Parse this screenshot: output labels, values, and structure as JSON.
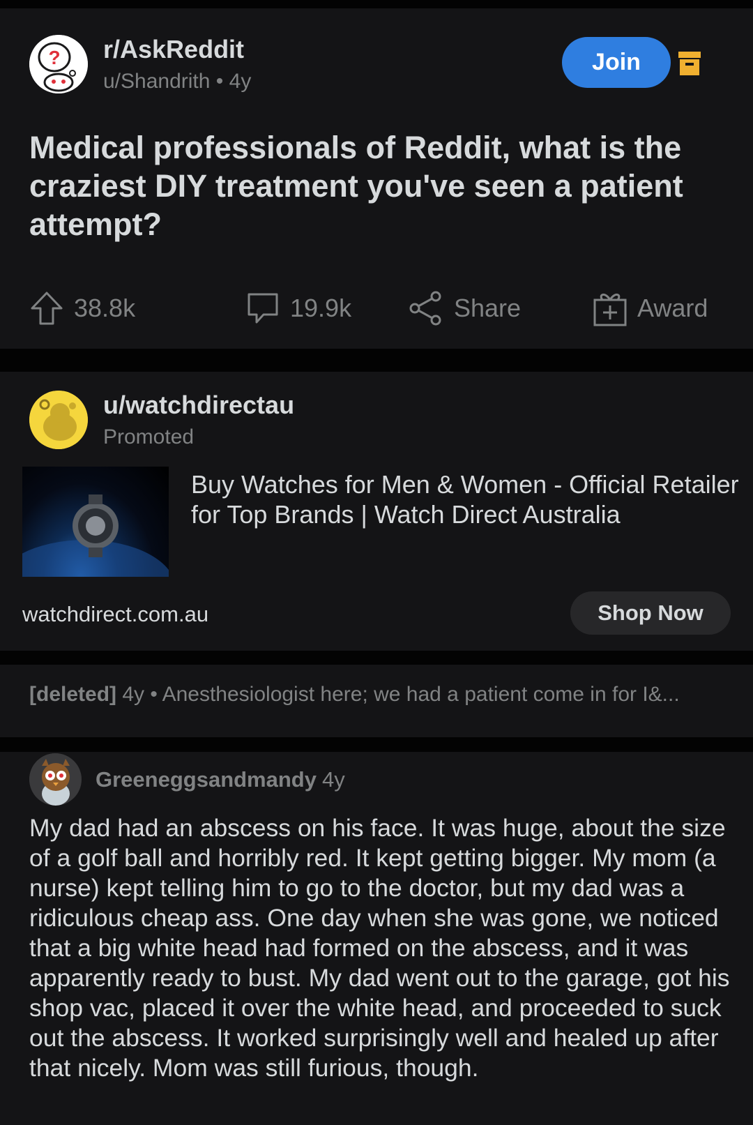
{
  "post": {
    "subreddit": "r/AskReddit",
    "author": "u/Shandrith",
    "separator": "•",
    "age": "4y",
    "join_label": "Join",
    "title": "Medical professionals of Reddit, what is the craziest DIY treatment you've seen a patient attempt?",
    "actions": {
      "upvotes": "38.8k",
      "comments": "19.9k",
      "share": "Share",
      "award": "Award"
    }
  },
  "ad": {
    "user": "u/watchdirectau",
    "label": "Promoted",
    "headline": "Buy Watches for Men & Women - Official Retailer for Top Brands | Watch Direct Australia",
    "domain": "watchdirect.com.au",
    "cta": "Shop Now"
  },
  "collapsed_comment": {
    "author": "[deleted]",
    "age": "4y",
    "separator": "•",
    "preview": "Anesthesiologist here; we had a patient come in for I&..."
  },
  "comment": {
    "author": "Greeneggsandmandy",
    "age": "4y",
    "body": "My dad had an abscess on his face.  It was huge, about the size of a golf ball and horribly red.  It kept getting bigger.  My mom (a nurse) kept telling him to go to the doctor, but my dad was a ridiculous cheap ass.  One day when she was gone, we noticed that a big white head had formed on the abscess, and it was apparently ready to bust.  My dad went out to the garage, got his shop vac, placed it over the white head, and proceeded to suck out the abscess.  It worked surprisingly well and healed up after that nicely.  Mom was still furious, though."
  },
  "colors": {
    "background": "#030303",
    "card": "#141416",
    "join": "#2f7ee0",
    "archive": "#f0b030",
    "muted": "#818384",
    "text": "#d7dadc"
  },
  "icons": [
    "subreddit-avatar-icon",
    "archive-icon",
    "upvote-icon",
    "comment-icon",
    "share-icon",
    "award-icon",
    "advertiser-avatar-icon",
    "commenter-avatar-icon"
  ]
}
